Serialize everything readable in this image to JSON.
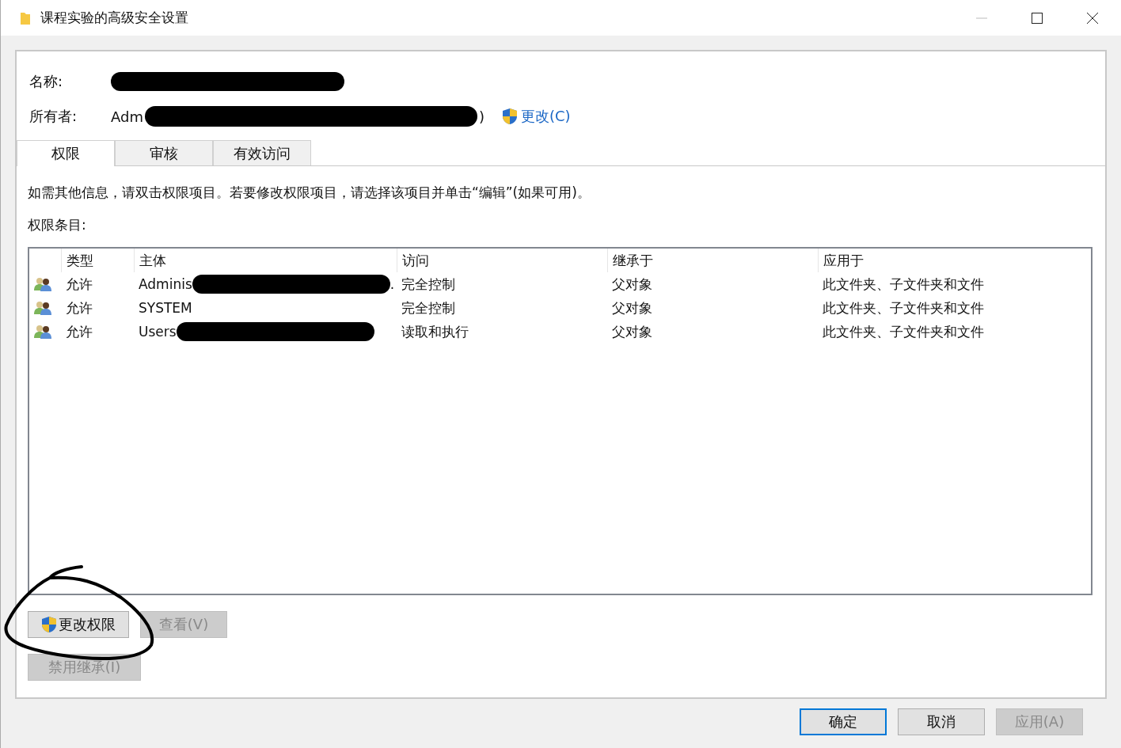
{
  "window": {
    "title": "课程实验的高级安全设置"
  },
  "name_field": {
    "label": "名称:"
  },
  "owner_field": {
    "label": "所有者:",
    "value_start": "Adm",
    "value_end": ")",
    "change_link": "更改(C)"
  },
  "tabs": [
    {
      "label": "权限",
      "selected": true
    },
    {
      "label": "审核",
      "selected": false
    },
    {
      "label": "有效访问",
      "selected": false
    }
  ],
  "info_text": "如需其他信息，请双击权限项目。若要修改权限项目，请选择该项目并单击“编辑”(如果可用)。",
  "entries_label": "权限条目:",
  "table": {
    "columns": [
      "类型",
      "主体",
      "访问",
      "继承于",
      "应用于"
    ],
    "rows": [
      {
        "type": "允许",
        "principal": "Adminis",
        "principal_end": ".",
        "access": "完全控制",
        "inherited_from": "父对象",
        "applies_to": "此文件夹、子文件夹和文件",
        "redacted": true
      },
      {
        "type": "允许",
        "principal": "SYSTEM",
        "principal_end": "",
        "access": "完全控制",
        "inherited_from": "父对象",
        "applies_to": "此文件夹、子文件夹和文件",
        "redacted": false
      },
      {
        "type": "允许",
        "principal": "Users",
        "principal_end": "",
        "access": "读取和执行",
        "inherited_from": "父对象",
        "applies_to": "此文件夹、子文件夹和文件",
        "redacted": true
      }
    ]
  },
  "buttons": [
    {
      "label": "更改权限",
      "disabled": false,
      "shield": true
    },
    {
      "label": "查看(V)",
      "disabled": true,
      "shield": false
    }
  ],
  "inherit_button": {
    "label": "禁用继承(I)",
    "disabled": true
  },
  "dialog_buttons": [
    {
      "label": "确定",
      "disabled": false,
      "default": true
    },
    {
      "label": "取消",
      "disabled": false,
      "default": false
    },
    {
      "label": "应用(A)",
      "disabled": true,
      "default": false
    }
  ]
}
